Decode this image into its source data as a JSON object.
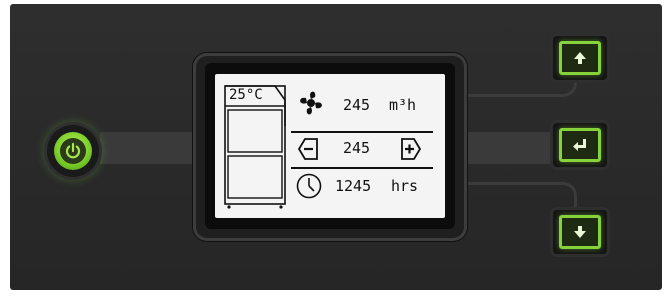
{
  "controls": {
    "power_icon": "power-icon",
    "up_icon": "arrow-up-icon",
    "enter_icon": "enter-return-icon",
    "down_icon": "arrow-down-icon",
    "accent_color": "#86d23a"
  },
  "display": {
    "temperature": "25°C",
    "airflow_value": "245",
    "airflow_unit": "m³h",
    "setpoint_value": "245",
    "hours_value": "1245",
    "hours_unit": "hrs"
  }
}
